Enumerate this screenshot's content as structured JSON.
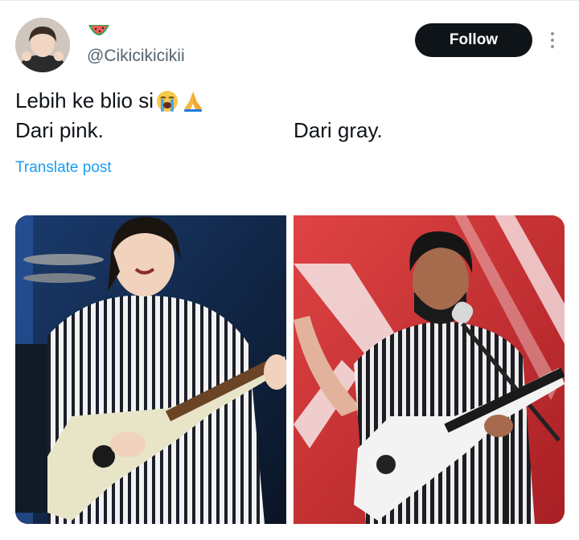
{
  "tweet": {
    "name_emoji": "🍉",
    "handle": "@Cikicikicikii",
    "follow_label": "Follow",
    "lines": {
      "line1": "Lebih ke blio si",
      "line1_emojis": "😭🙏",
      "line2": "Dari pink.",
      "line3": "Dari gray."
    },
    "translate_label": "Translate post"
  },
  "colors": {
    "accent": "#1d9bf0",
    "follow_bg": "#0f1419",
    "secondary_text": "#536471"
  },
  "icons": {
    "name_emoji": "watermelon-icon",
    "crying": "loudly-crying-face-icon",
    "pray": "folded-hands-icon",
    "more": "more-options-icon"
  }
}
